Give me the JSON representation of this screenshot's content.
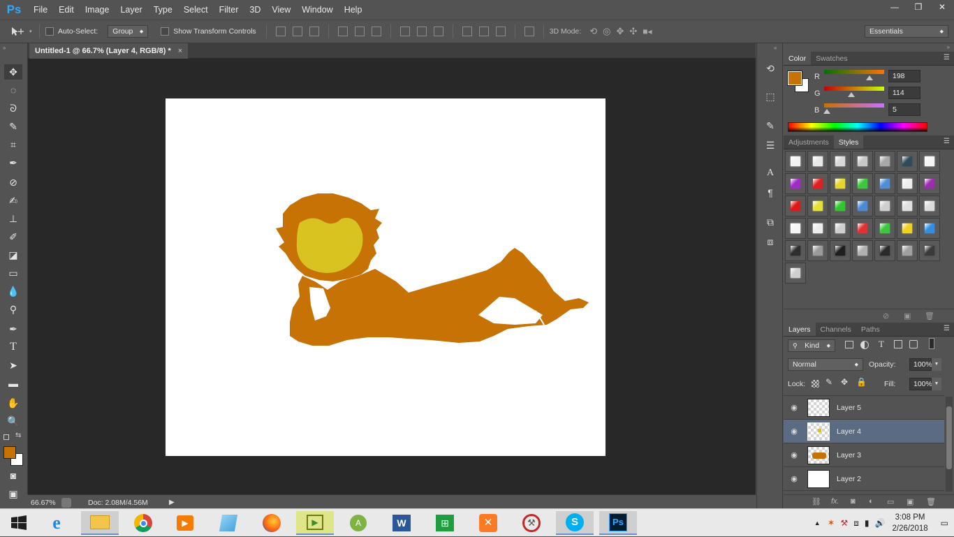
{
  "app": {
    "logo": "Ps",
    "menu": [
      "File",
      "Edit",
      "Image",
      "Layer",
      "Type",
      "Select",
      "Filter",
      "3D",
      "View",
      "Window",
      "Help"
    ],
    "window_controls": [
      "—",
      "❐",
      "✕"
    ]
  },
  "options_bar": {
    "auto_select_label": "Auto-Select:",
    "auto_select_value": "Group",
    "show_transform_label": "Show Transform Controls",
    "mode_3d_label": "3D Mode:",
    "workspace": "Essentials"
  },
  "document": {
    "tab_title": "Untitled-1 @ 66.7% (Layer 4, RGB/8) *",
    "tab_close": "×"
  },
  "status_bar": {
    "zoom": "66.67%",
    "doc_info": "Doc: 2.08M/4.56M"
  },
  "color_panel": {
    "tabs": [
      "Color",
      "Swatches"
    ],
    "active_tab": "Color",
    "channels": [
      {
        "label": "R",
        "value": "198",
        "fraction": 0.776
      },
      {
        "label": "G",
        "value": "114",
        "fraction": 0.447
      },
      {
        "label": "B",
        "value": "5",
        "fraction": 0.02
      }
    ],
    "foreground": "#c67205",
    "background": "#ffffff"
  },
  "styles_panel": {
    "tabs": [
      "Adjustments",
      "Styles"
    ],
    "active_tab": "Styles",
    "swatch_colors": [
      [
        "#f2f2f2",
        "#e8e8e8",
        "#d9d9d9",
        "#c8c8c8",
        "#a8a8a8",
        "#2f4a5a",
        "#f5f5f5"
      ],
      [
        "#a02cc8",
        "#e02020",
        "#e6d52a",
        "#39c83a",
        "#4f8fd6",
        "#eeeeee",
        "#9c2cb0"
      ],
      [
        "#e01818",
        "#e5e033",
        "#2ec82e",
        "#4c8ad8",
        "#cfcfcf",
        "#e0e0e0",
        "#dcdcdc"
      ],
      [
        "#f5f5f5",
        "#ededed",
        "#cfcfcf",
        "#e23030",
        "#3cc83c",
        "#f0d020",
        "#2f8fe0"
      ],
      [
        "#2e2e2e",
        "#9a9a9a",
        "#1e1e1e",
        "#b0b0b0",
        "#2a2a2a",
        "#a0a0a0",
        "#3a3a3a"
      ],
      [
        "#cfcfcf"
      ]
    ]
  },
  "layers_panel": {
    "tabs": [
      "Layers",
      "Channels",
      "Paths"
    ],
    "active_tab": "Layers",
    "filter_label": "Kind",
    "blend_mode": "Normal",
    "opacity_label": "Opacity:",
    "opacity_value": "100%",
    "lock_label": "Lock:",
    "fill_label": "Fill:",
    "fill_value": "100%",
    "layers": [
      {
        "name": "Layer 5",
        "selected": false
      },
      {
        "name": "Layer 4",
        "selected": true
      },
      {
        "name": "Layer 3",
        "selected": false
      },
      {
        "name": "Layer 2",
        "selected": false
      }
    ],
    "footer_icons": [
      "link-icon",
      "fx-icon",
      "mask-icon",
      "adjustment-icon",
      "folder-icon",
      "new-layer-icon",
      "trash-icon"
    ],
    "fx_label": "fx."
  },
  "taskbar": {
    "time": "3:08 PM",
    "date": "2/26/2018"
  }
}
